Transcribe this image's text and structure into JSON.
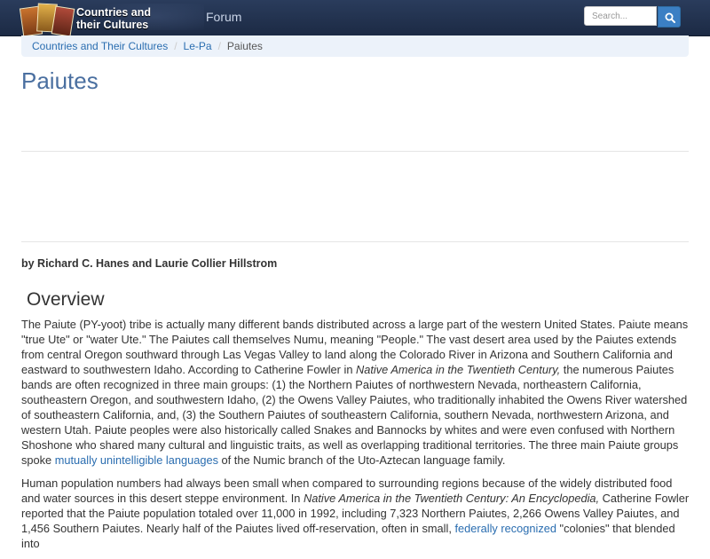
{
  "navbar": {
    "brand_line1": "Countries and",
    "brand_line2": "their Cultures",
    "forum_label": "Forum",
    "search_placeholder": "Search..."
  },
  "breadcrumb": {
    "items": [
      "Countries and Their Cultures",
      "Le-Pa",
      "Paiutes"
    ]
  },
  "page": {
    "title": "Paiutes",
    "byline": "by Richard C. Hanes and Laurie Collier Hillstrom",
    "section_heading": "Overview"
  },
  "paragraph1": {
    "t1": "The Paiute (PY-yoot) tribe is actually many different bands distributed across a large part of the western United States. Paiute means \"true Ute\" or \"water Ute.\" The Paiutes call themselves Numu, meaning \"People.\" The vast desert area used by the Paiutes extends from central Oregon southward through Las Vegas Valley to land along the Colorado River in Arizona and Southern California and eastward to southwestern Idaho. According to Catherine Fowler in ",
    "em1": "Native America in the Twentieth Century,",
    "t2": " the numerous Paiutes bands are often recognized in three main groups: (1) the Northern Paiutes of northwestern Nevada, northeastern California, southeastern Oregon, and southwestern Idaho, (2) the Owens Valley Paiutes, who traditionally inhabited the Owens River watershed of southeastern California, and, (3) the Southern Paiutes of southeastern California, southern Nevada, northwestern Arizona, and western Utah. Paiute peoples were also historically called Snakes and Bannocks by whites and were even confused with Northern Shoshone who shared many cultural and linguistic traits, as well as overlapping traditional territories. The three main Paiute groups spoke ",
    "link1": "mutually unintelligible languages",
    "t3": " of the Numic branch of the Uto-Aztecan language family."
  },
  "paragraph2": {
    "t1": "Human population numbers had always been small when compared to surrounding regions because of the widely distributed food and water sources in this desert steppe environment. In ",
    "em1": "Native America in the Twentieth Century: An Encyclopedia,",
    "t2": " Catherine Fowler reported that the Paiute population totaled over 11,000 in 1992, including 7,323 Northern Paiutes, 2,266 Owens Valley Paiutes, and 1,456 Southern Paiutes. Nearly half of the Paiutes lived off-reservation, often in small, ",
    "link1": "federally recognized",
    "t3": " \"colonies\" that blended into"
  },
  "colors": {
    "navbar": "#1c2a44",
    "link": "#2a6db0",
    "title": "#4a6fa0",
    "breadcrumb_bg": "#ecf2fa",
    "search_button": "#3b7fc4"
  },
  "icons": {
    "search": "magnifier-icon",
    "logo": "culture-photo-collage"
  }
}
